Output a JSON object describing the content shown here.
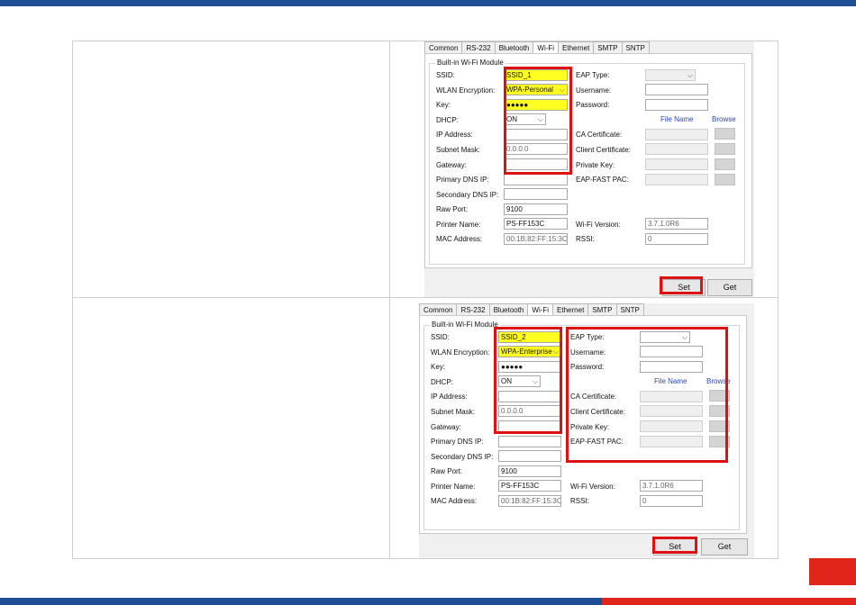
{
  "panels": [
    {
      "tabs": [
        "Common",
        "RS-232",
        "Bluetooth",
        "Wi-Fi",
        "Ethernet",
        "SMTP",
        "SNTP"
      ],
      "active_tab": "Wi-Fi",
      "group_title": "Built-in Wi-Fi Module",
      "labels": {
        "ssid": "SSID:",
        "encryption": "WLAN Encryption:",
        "key": "Key:",
        "dhcp": "DHCP:",
        "ip": "IP Address:",
        "subnet": "Subnet Mask:",
        "gateway": "Gateway:",
        "dns1": "Primary DNS IP:",
        "dns2": "Secondary DNS IP:",
        "raw_port": "Raw Port:",
        "printer_name": "Printer Name:",
        "mac": "MAC Address:",
        "eap_type": "EAP Type:",
        "username": "Username:",
        "password": "Password:",
        "file_name": "File Name",
        "browse": "Browse",
        "ca_cert": "CA Certificate:",
        "client_cert": "Client Certificate:",
        "private_key": "Private Key:",
        "eap_fast_pac": "EAP-FAST PAC:",
        "wifi_version": "Wi-Fi Version:",
        "rssi": "RSSI:"
      },
      "values": {
        "ssid": "SSID_1",
        "encryption": "WPA-Personal",
        "key": "●●●●●",
        "dhcp": "ON",
        "subnet": "0.0.0.0",
        "raw_port": "9100",
        "printer_name": "PS-FF153C",
        "mac": "00:1B:82:FF:15:3C",
        "wifi_version": "3.7.1.0R6",
        "rssi": "0"
      },
      "buttons": {
        "set": "Set",
        "get": "Get"
      }
    },
    {
      "tabs": [
        "Common",
        "RS-232",
        "Bluetooth",
        "Wi-Fi",
        "Ethernet",
        "SMTP",
        "SNTP"
      ],
      "active_tab": "Wi-Fi",
      "group_title": "Built-in Wi-Fi Module",
      "labels": {
        "ssid": "SSID:",
        "encryption": "WLAN Encryption:",
        "key": "Key:",
        "dhcp": "DHCP:",
        "ip": "IP Address:",
        "subnet": "Subnet Mask:",
        "gateway": "Gateway:",
        "dns1": "Primary DNS IP:",
        "dns2": "Secondary DNS IP:",
        "raw_port": "Raw Port:",
        "printer_name": "Printer Name:",
        "mac": "MAC Address:",
        "eap_type": "EAP Type:",
        "username": "Username:",
        "password": "Password:",
        "file_name": "File Name",
        "browse": "Browse",
        "ca_cert": "CA Certificate:",
        "client_cert": "Client Certificate:",
        "private_key": "Private Key:",
        "eap_fast_pac": "EAP-FAST PAC:",
        "wifi_version": "Wi-Fi Version:",
        "rssi": "RSSI:"
      },
      "values": {
        "ssid": "SSID_2",
        "encryption": "WPA-Enterprise",
        "key": "●●●●●",
        "dhcp": "ON",
        "subnet": "0.0.0.0",
        "raw_port": "9100",
        "printer_name": "PS-FF153C",
        "mac": "00:1B:82:FF:15:3C",
        "wifi_version": "3.7.1.0R6",
        "rssi": "0"
      },
      "buttons": {
        "set": "Set",
        "get": "Get"
      }
    }
  ],
  "colors": {
    "brand_blue": "#1f4e96",
    "brand_red": "#e1251b",
    "highlight_yellow": "#ffff22",
    "annotation_red": "#dd1111"
  }
}
